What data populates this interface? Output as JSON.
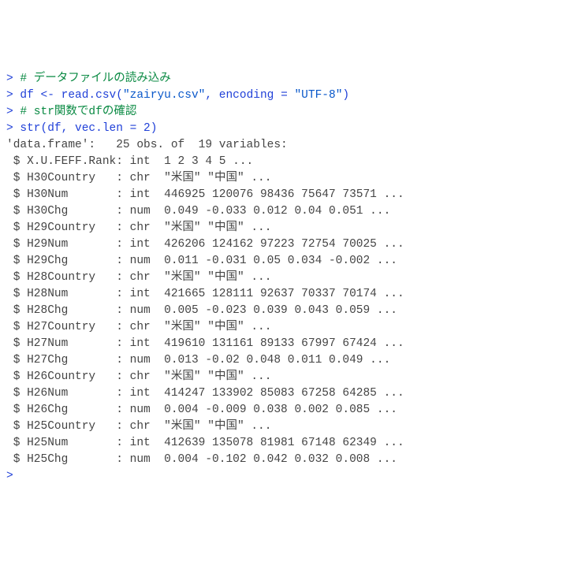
{
  "console": {
    "lines": [
      {
        "kind": "input",
        "segments": [
          {
            "cls": "prompt",
            "t": "> "
          },
          {
            "cls": "comment",
            "t": "# データファイルの読み込み"
          }
        ]
      },
      {
        "kind": "input",
        "segments": [
          {
            "cls": "prompt",
            "t": "> "
          },
          {
            "cls": "cmd",
            "t": "df <- read.csv("
          },
          {
            "cls": "str",
            "t": "\"zairyu.csv\""
          },
          {
            "cls": "cmd",
            "t": ", encoding = "
          },
          {
            "cls": "str",
            "t": "\"UTF-8\""
          },
          {
            "cls": "cmd",
            "t": ")"
          }
        ]
      },
      {
        "kind": "input",
        "segments": [
          {
            "cls": "prompt",
            "t": "> "
          },
          {
            "cls": "comment",
            "t": "# str関数でdfの確認"
          }
        ]
      },
      {
        "kind": "input",
        "segments": [
          {
            "cls": "prompt",
            "t": "> "
          },
          {
            "cls": "cmd",
            "t": "str(df, vec.len = "
          },
          {
            "cls": "num",
            "t": "2"
          },
          {
            "cls": "cmd",
            "t": ")"
          }
        ]
      },
      {
        "kind": "output",
        "segments": [
          {
            "cls": "out",
            "t": "'data.frame':   25 obs. of  19 variables:"
          }
        ]
      },
      {
        "kind": "output",
        "segments": [
          {
            "cls": "out",
            "t": " $ X.U.FEFF.Rank: int  1 2 3 4 5 ..."
          }
        ]
      },
      {
        "kind": "output",
        "segments": [
          {
            "cls": "out",
            "t": " $ H30Country   : chr  \"米国\" \"中国\" ..."
          }
        ]
      },
      {
        "kind": "output",
        "segments": [
          {
            "cls": "out",
            "t": " $ H30Num       : int  446925 120076 98436 75647 73571 ..."
          }
        ]
      },
      {
        "kind": "output",
        "segments": [
          {
            "cls": "out",
            "t": " $ H30Chg       : num  0.049 -0.033 0.012 0.04 0.051 ..."
          }
        ]
      },
      {
        "kind": "output",
        "segments": [
          {
            "cls": "out",
            "t": " $ H29Country   : chr  \"米国\" \"中国\" ..."
          }
        ]
      },
      {
        "kind": "output",
        "segments": [
          {
            "cls": "out",
            "t": " $ H29Num       : int  426206 124162 97223 72754 70025 ..."
          }
        ]
      },
      {
        "kind": "output",
        "segments": [
          {
            "cls": "out",
            "t": " $ H29Chg       : num  0.011 -0.031 0.05 0.034 -0.002 ..."
          }
        ]
      },
      {
        "kind": "output",
        "segments": [
          {
            "cls": "out",
            "t": " $ H28Country   : chr  \"米国\" \"中国\" ..."
          }
        ]
      },
      {
        "kind": "output",
        "segments": [
          {
            "cls": "out",
            "t": " $ H28Num       : int  421665 128111 92637 70337 70174 ..."
          }
        ]
      },
      {
        "kind": "output",
        "segments": [
          {
            "cls": "out",
            "t": " $ H28Chg       : num  0.005 -0.023 0.039 0.043 0.059 ..."
          }
        ]
      },
      {
        "kind": "output",
        "segments": [
          {
            "cls": "out",
            "t": " $ H27Country   : chr  \"米国\" \"中国\" ..."
          }
        ]
      },
      {
        "kind": "output",
        "segments": [
          {
            "cls": "out",
            "t": " $ H27Num       : int  419610 131161 89133 67997 67424 ..."
          }
        ]
      },
      {
        "kind": "output",
        "segments": [
          {
            "cls": "out",
            "t": " $ H27Chg       : num  0.013 -0.02 0.048 0.011 0.049 ..."
          }
        ]
      },
      {
        "kind": "output",
        "segments": [
          {
            "cls": "out",
            "t": " $ H26Country   : chr  \"米国\" \"中国\" ..."
          }
        ]
      },
      {
        "kind": "output",
        "segments": [
          {
            "cls": "out",
            "t": " $ H26Num       : int  414247 133902 85083 67258 64285 ..."
          }
        ]
      },
      {
        "kind": "output",
        "segments": [
          {
            "cls": "out",
            "t": " $ H26Chg       : num  0.004 -0.009 0.038 0.002 0.085 ..."
          }
        ]
      },
      {
        "kind": "output",
        "segments": [
          {
            "cls": "out",
            "t": " $ H25Country   : chr  \"米国\" \"中国\" ..."
          }
        ]
      },
      {
        "kind": "output",
        "segments": [
          {
            "cls": "out",
            "t": " $ H25Num       : int  412639 135078 81981 67148 62349 ..."
          }
        ]
      },
      {
        "kind": "output",
        "segments": [
          {
            "cls": "out",
            "t": " $ H25Chg       : num  0.004 -0.102 0.042 0.032 0.008 ..."
          }
        ]
      },
      {
        "kind": "input",
        "segments": [
          {
            "cls": "prompt",
            "t": "> "
          }
        ]
      }
    ]
  }
}
